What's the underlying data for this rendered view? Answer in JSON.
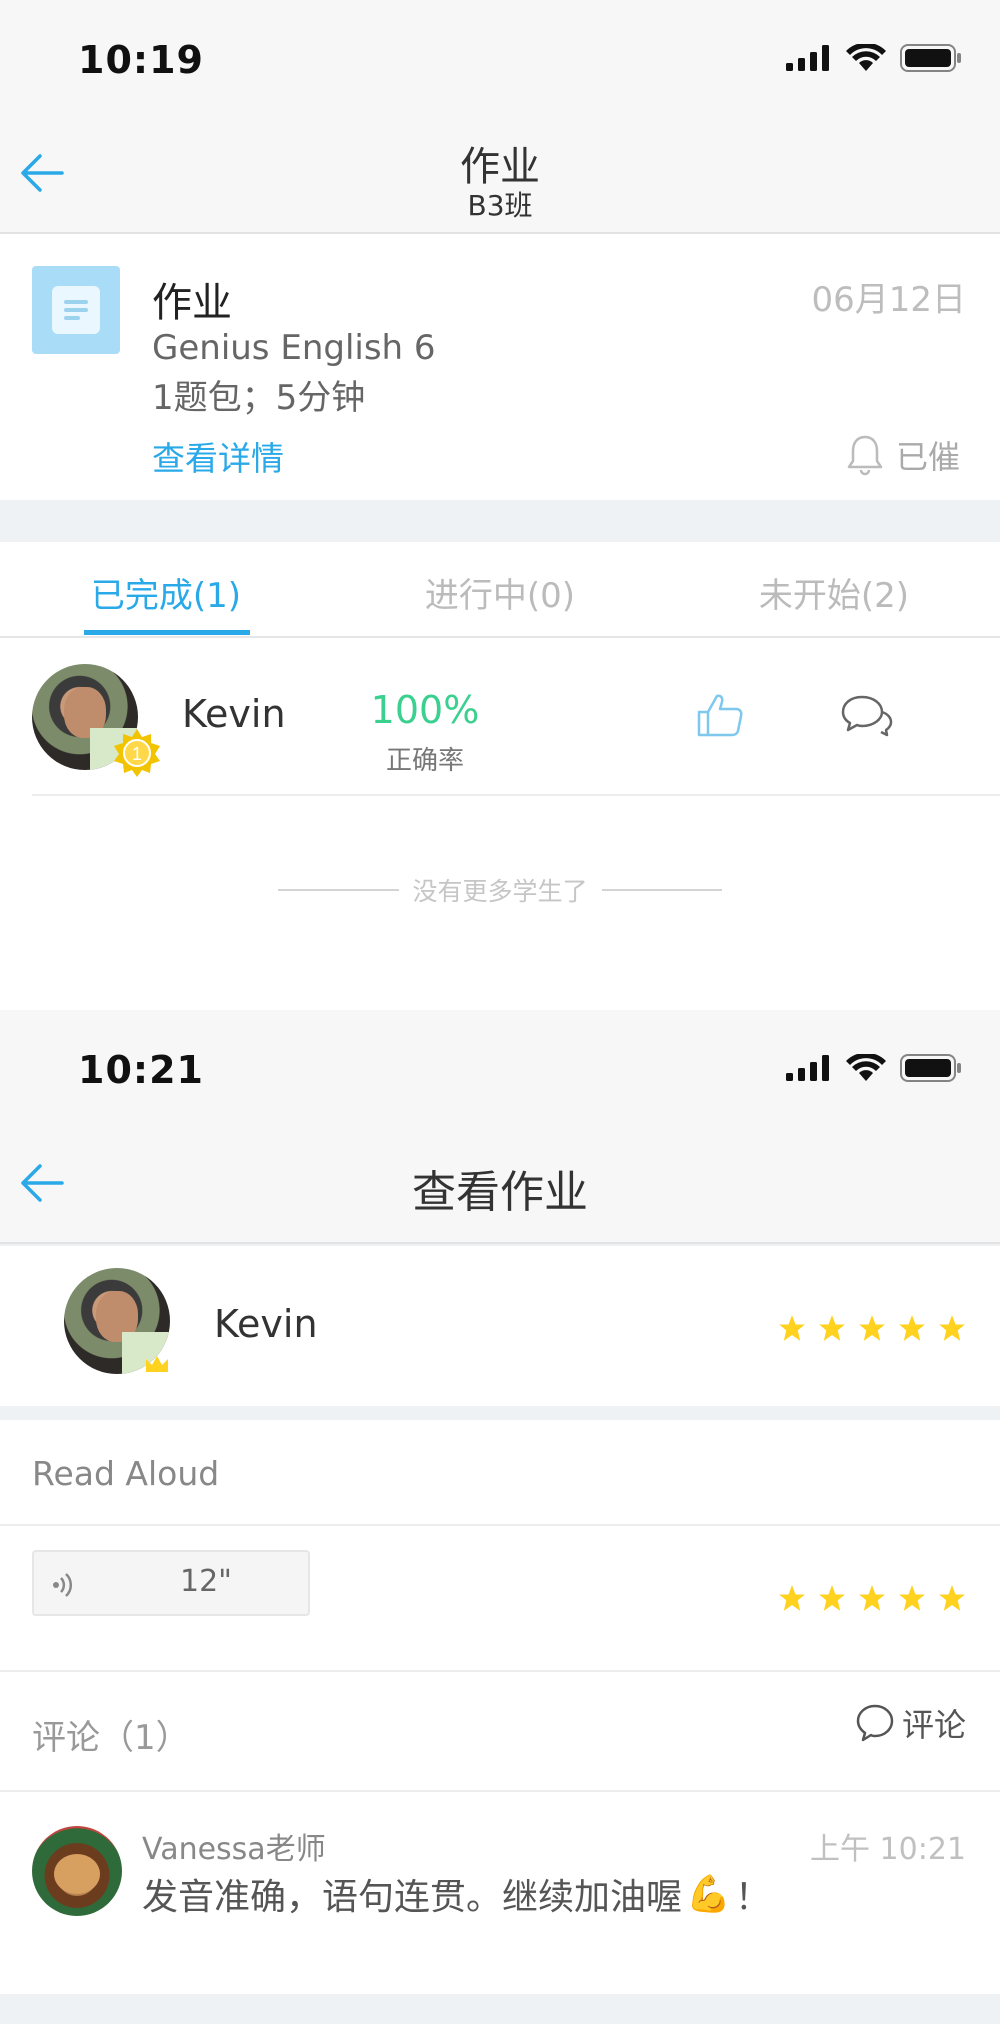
{
  "screen1": {
    "status": {
      "time": "10:19"
    },
    "nav": {
      "title": "作业",
      "subtitle": "B3班"
    },
    "homework": {
      "title": "作业",
      "date": "06月12日",
      "book": "Genius English 6",
      "meta": "1题包；5分钟",
      "detail_link": "查看详情",
      "remind_label": "已催"
    },
    "tabs": [
      {
        "label": "已完成(1)",
        "active": true
      },
      {
        "label": "进行中(0)",
        "active": false
      },
      {
        "label": "未开始(2)",
        "active": false
      }
    ],
    "students": [
      {
        "name": "Kevin",
        "rank": "1",
        "accuracy": "100%",
        "accuracy_label": "正确率"
      }
    ],
    "no_more": "没有更多学生了"
  },
  "screen2": {
    "status": {
      "time": "10:21"
    },
    "nav": {
      "title": "查看作业"
    },
    "student": {
      "name": "Kevin",
      "stars": 5
    },
    "section_title": "Read Aloud",
    "audio": {
      "duration": "12\"",
      "stars": 5
    },
    "comments_header": "评论（1）",
    "comment_button": "评论",
    "comment": {
      "author": "Vanessa老师",
      "time": "上午 10:21",
      "text": "发音准确，语句连贯。继续加油喔",
      "emoji": "💪",
      "suffix": "！"
    }
  },
  "colors": {
    "accent": "#2aa9e8",
    "success": "#3bd08f",
    "star": "#ffd21f"
  },
  "icons": [
    "back-arrow-icon",
    "signal-icon",
    "wifi-icon",
    "battery-icon",
    "document-icon",
    "bell-icon",
    "rank-badge-icon",
    "thumbs-up-icon",
    "chat-bubbles-icon",
    "star-icon",
    "speaker-icon",
    "comment-bubble-icon"
  ]
}
